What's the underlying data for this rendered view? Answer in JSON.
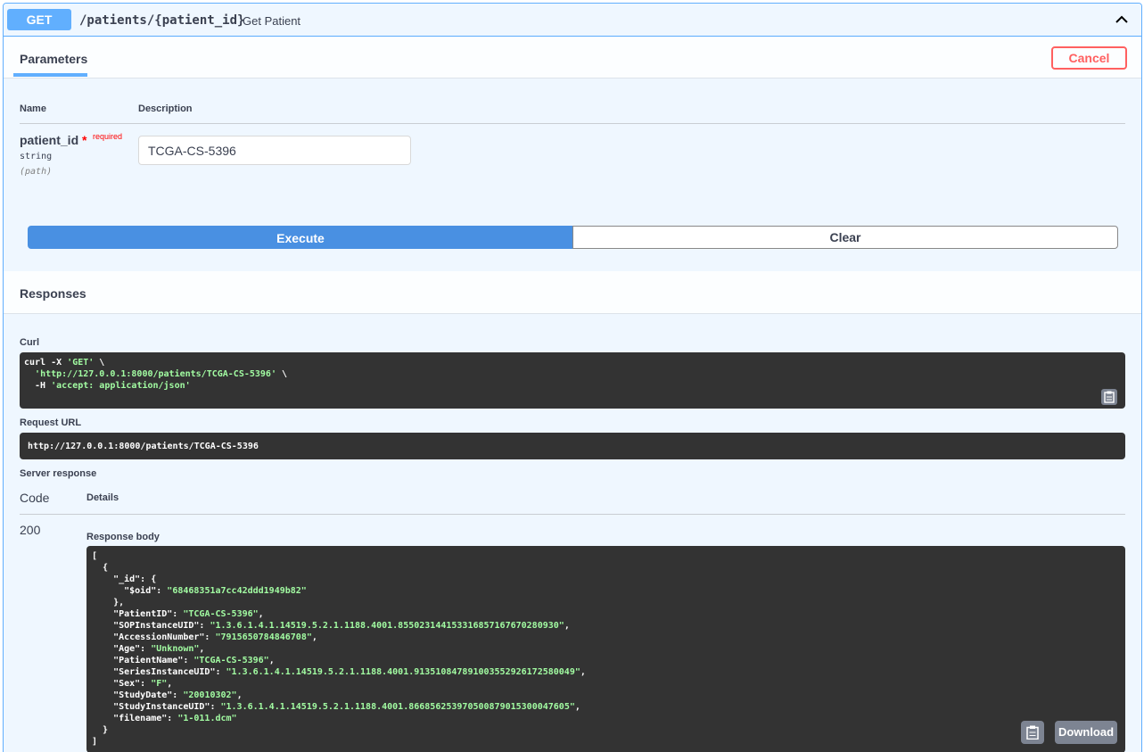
{
  "operation": {
    "method": "GET",
    "path": "/patients/{patient_id}",
    "summary": "Get Patient"
  },
  "tabs": {
    "parameters_label": "Parameters",
    "cancel_label": "Cancel"
  },
  "params_table": {
    "name_header": "Name",
    "description_header": "Description",
    "param": {
      "name": "patient_id",
      "required_star": "*",
      "required_label": "required",
      "type": "string",
      "in": "(path)",
      "value": "TCGA-CS-5396"
    }
  },
  "actions": {
    "execute_label": "Execute",
    "clear_label": "Clear"
  },
  "responses": {
    "title": "Responses",
    "curl_label": "Curl",
    "curl_lines": [
      {
        "pre": "curl -X ",
        "str": "'GET'",
        "post": " \\"
      },
      {
        "pre": "  ",
        "str": "'http://127.0.0.1:8000/patients/TCGA-CS-5396'",
        "post": " \\"
      },
      {
        "pre": "  -H ",
        "str": "'accept: application/json'",
        "post": ""
      }
    ],
    "request_url_label": "Request URL",
    "request_url": "http://127.0.0.1:8000/patients/TCGA-CS-5396",
    "server_response_label": "Server response",
    "code_header": "Code",
    "details_header": "Details",
    "status_code": "200",
    "response_body_label": "Response body",
    "download_label": "Download",
    "body_lines": [
      {
        "pre": "[",
        "str": "",
        "post": ""
      },
      {
        "pre": "  {",
        "str": "",
        "post": ""
      },
      {
        "pre": "    \"_id\": {",
        "str": "",
        "post": ""
      },
      {
        "pre": "      \"$oid\": ",
        "str": "\"68468351a7cc42ddd1949b82\"",
        "post": ""
      },
      {
        "pre": "    },",
        "str": "",
        "post": ""
      },
      {
        "pre": "    \"PatientID\": ",
        "str": "\"TCGA-CS-5396\"",
        "post": ","
      },
      {
        "pre": "    \"SOPInstanceUID\": ",
        "str": "\"1.3.6.1.4.1.14519.5.2.1.1188.4001.855023144153316857167670280930\"",
        "post": ","
      },
      {
        "pre": "    \"AccessionNumber\": ",
        "str": "\"7915650784846708\"",
        "post": ","
      },
      {
        "pre": "    \"Age\": ",
        "str": "\"Unknown\"",
        "post": ","
      },
      {
        "pre": "    \"PatientName\": ",
        "str": "\"TCGA-CS-5396\"",
        "post": ","
      },
      {
        "pre": "    \"SeriesInstanceUID\": ",
        "str": "\"1.3.6.1.4.1.14519.5.2.1.1188.4001.913510847891003552926172580049\"",
        "post": ","
      },
      {
        "pre": "    \"Sex\": ",
        "str": "\"F\"",
        "post": ","
      },
      {
        "pre": "    \"StudyDate\": ",
        "str": "\"20010302\"",
        "post": ","
      },
      {
        "pre": "    \"StudyInstanceUID\": ",
        "str": "\"1.3.6.1.4.1.14519.5.2.1.1188.4001.866856253970500879015300047605\"",
        "post": ","
      },
      {
        "pre": "    \"filename\": ",
        "str": "\"1-011.dcm\"",
        "post": ""
      },
      {
        "pre": "  }",
        "str": "",
        "post": ""
      },
      {
        "pre": "]",
        "str": "",
        "post": ""
      }
    ]
  },
  "colors": {
    "get_blue": "#61affe",
    "execute_blue": "#4990e2",
    "cancel_red": "#ff6060",
    "code_bg": "#333333",
    "string_green": "#a2fca2"
  },
  "icons": {
    "collapse": "chevron-up-icon",
    "copy": "clipboard-icon"
  }
}
